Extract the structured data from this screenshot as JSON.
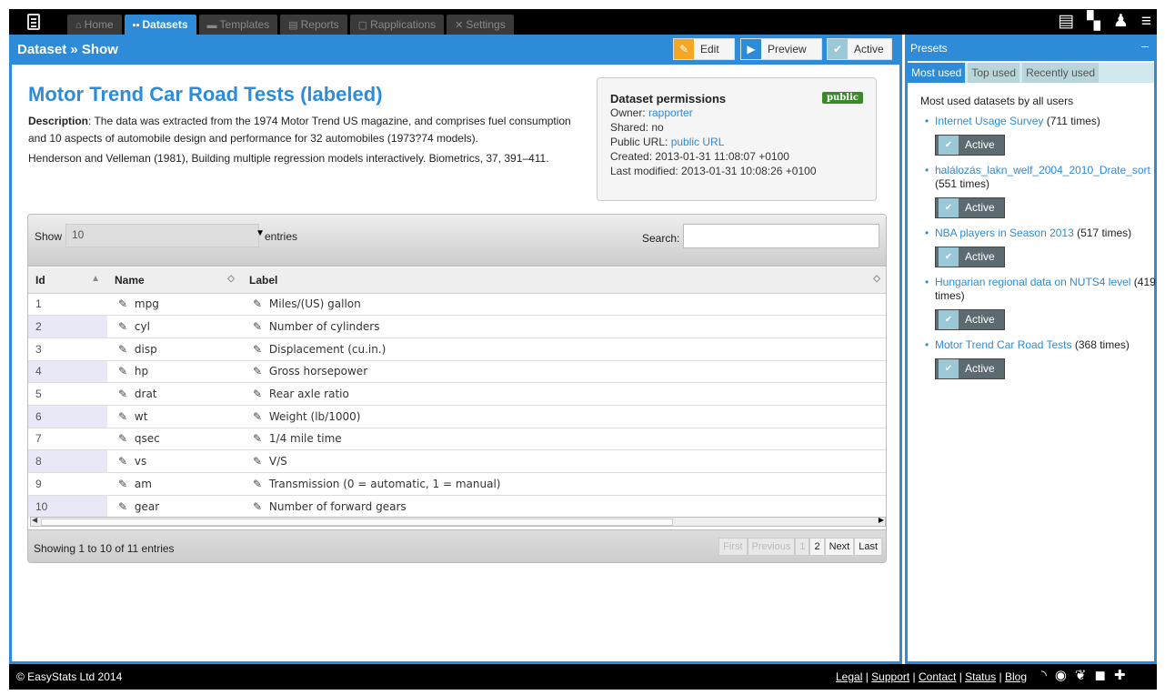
{
  "nav": {
    "tabs": [
      {
        "label": "Home",
        "icon": "home-icon"
      },
      {
        "label": "Datasets",
        "icon": "grid-icon"
      },
      {
        "label": "Templates",
        "icon": "folder-icon"
      },
      {
        "label": "Reports",
        "icon": "document-icon"
      },
      {
        "label": "Rapplications",
        "icon": "file-icon"
      },
      {
        "label": "Settings",
        "icon": "wrench-icon"
      }
    ],
    "active_tab": "Datasets",
    "right_icons": [
      "document-icon",
      "grid-icon",
      "user-icon",
      "menu-icon"
    ]
  },
  "main": {
    "breadcrumb": "Dataset » Show",
    "buttons": {
      "edit": "Edit",
      "preview": "Preview",
      "active": "Active"
    },
    "title": "Motor Trend Car Road Tests (labeled)",
    "description_label": "Description",
    "description": ": The data was extracted from the 1974 Motor Trend US magazine, and comprises fuel consumption and 10 aspects of automobile design and performance for 32 automobiles (1973?74 models).",
    "reference": "Henderson and Velleman (1981), Building multiple regression models interactively. Biometrics, 37, 391–411."
  },
  "permissions": {
    "title": "Dataset permissions",
    "badge": "public",
    "owner_label": "Owner: ",
    "owner": "rapporter",
    "shared": "Shared: no",
    "public_url_label": "Public URL: ",
    "public_url": "public URL",
    "created": "Created: 2013-01-31 11:08:07 +0100",
    "modified": "Last modified: 2013-01-31 10:08:26 +0100"
  },
  "table": {
    "show_label": "Show",
    "show_value": "10",
    "entries_label": "entries",
    "search_label": "Search:",
    "search_value": "",
    "headers": {
      "id": "Id",
      "name": "Name",
      "label": "Label"
    },
    "rows": [
      {
        "id": "1",
        "name": "mpg",
        "label": "Miles/(US) gallon"
      },
      {
        "id": "2",
        "name": "cyl",
        "label": "Number of cylinders"
      },
      {
        "id": "3",
        "name": "disp",
        "label": "Displacement (cu.in.)"
      },
      {
        "id": "4",
        "name": "hp",
        "label": "Gross horsepower"
      },
      {
        "id": "5",
        "name": "drat",
        "label": "Rear axle ratio"
      },
      {
        "id": "6",
        "name": "wt",
        "label": "Weight (lb/1000)"
      },
      {
        "id": "7",
        "name": "qsec",
        "label": "1/4 mile time"
      },
      {
        "id": "8",
        "name": "vs",
        "label": "V/S"
      },
      {
        "id": "9",
        "name": "am",
        "label": "Transmission (0 = automatic, 1 = manual)"
      },
      {
        "id": "10",
        "name": "gear",
        "label": "Number of forward gears"
      }
    ],
    "scroll_mark": "III",
    "info": "Showing 1 to 10 of 11 entries",
    "pager": {
      "first": "First",
      "previous": "Previous",
      "p1": "1",
      "p2": "2",
      "next": "Next",
      "last": "Last"
    }
  },
  "presets": {
    "title": "Presets",
    "minimize": "–",
    "tabs": [
      "Most used",
      "Top used",
      "Recently used"
    ],
    "heading": "Most used datasets by all users",
    "button_label": "Active",
    "items": [
      {
        "name": "Internet Usage Survey",
        "count": " (711 times)"
      },
      {
        "name": "halálozás_lakn_welf_2004_2010_Drate_sort",
        "count": " (551 times)"
      },
      {
        "name": "NBA players in Season 2013",
        "count": " (517 times)"
      },
      {
        "name": "Hungarian regional data on NUTS4 level",
        "count": " (419 times)"
      },
      {
        "name": "Motor Trend Car Road Tests",
        "count": " (368 times)"
      }
    ]
  },
  "footer": {
    "copyright": "© EasyStats Ltd 2014",
    "links": [
      "Legal",
      "Support",
      "Contact",
      "Status",
      "Blog"
    ],
    "social_icons": [
      "rss-icon",
      "github-icon",
      "twitter-icon",
      "facebook-icon",
      "google-plus-icon"
    ]
  },
  "colors": {
    "accent": "#2d8bd8",
    "edit": "#f5a623",
    "public_badge": "#3a8a2a"
  }
}
